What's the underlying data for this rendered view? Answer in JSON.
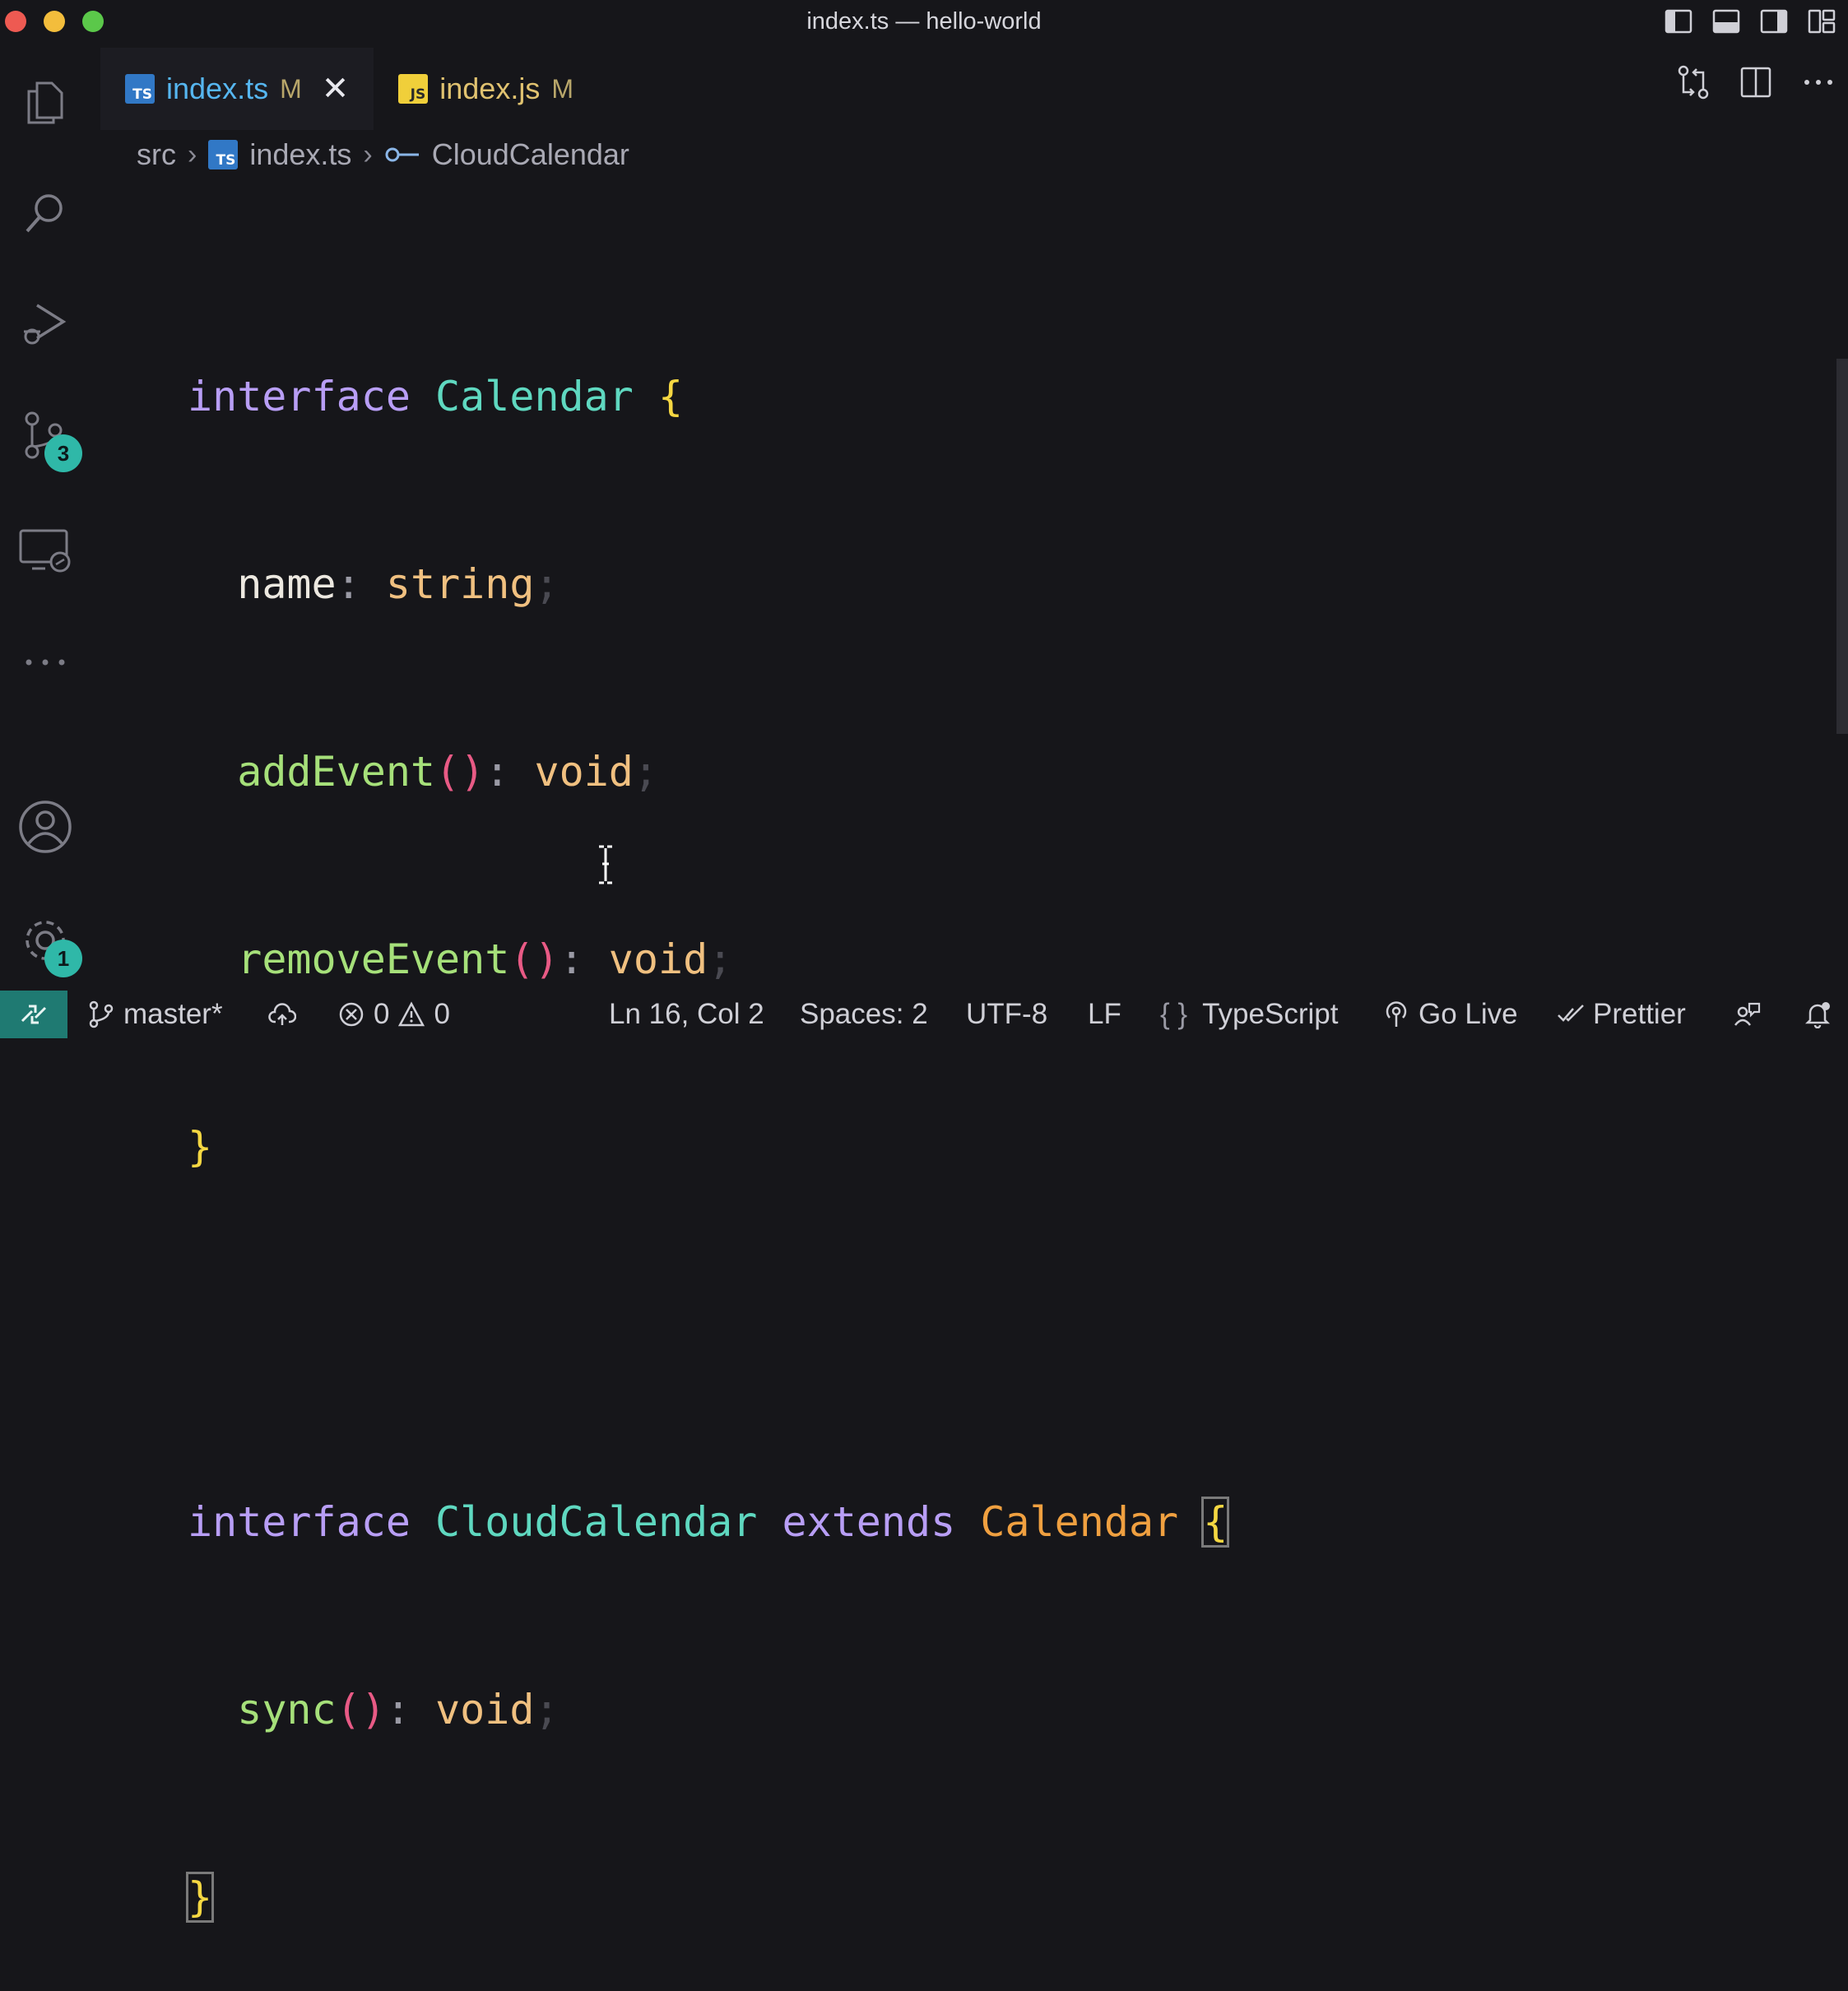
{
  "window": {
    "title": "index.ts — hello-world",
    "traffic_colors": {
      "close": "#ee5a52",
      "minimize": "#f3bd3c",
      "maximize": "#5bc84a"
    }
  },
  "activity_bar": {
    "items": [
      {
        "name": "explorer",
        "icon": "files-icon"
      },
      {
        "name": "search",
        "icon": "search-icon"
      },
      {
        "name": "run-debug",
        "icon": "run-debug-icon"
      },
      {
        "name": "source-control",
        "icon": "source-control-icon",
        "badge": "3"
      },
      {
        "name": "remote-explorer",
        "icon": "remote-explorer-icon"
      },
      {
        "name": "more",
        "icon": "ellipsis-icon"
      }
    ],
    "bottom": [
      {
        "name": "accounts",
        "icon": "account-icon"
      },
      {
        "name": "manage",
        "icon": "gear-icon",
        "badge": "1"
      }
    ]
  },
  "tabs": [
    {
      "label": "index.ts",
      "icon_text": "TS",
      "modified": "M",
      "active": true
    },
    {
      "label": "index.js",
      "icon_text": "JS",
      "modified": "M",
      "active": false
    }
  ],
  "breadcrumb": {
    "folder": "src",
    "file": "index.ts",
    "file_icon_text": "TS",
    "symbol": "CloudCalendar"
  },
  "code": {
    "lines": [
      "",
      "interface Calendar {",
      "  name: string;",
      "  addEvent(): void;",
      "  removeEvent(): void;",
      "}",
      "",
      "interface CloudCalendar extends Calendar {",
      "  sync(): void;",
      "}"
    ],
    "tokens": {
      "interface": "interface",
      "calendar": "Calendar",
      "cloud_calendar": "CloudCalendar",
      "extends": "extends",
      "name": "name",
      "string": "string",
      "add_event": "addEvent",
      "remove_event": "removeEvent",
      "sync": "sync",
      "void": "void",
      "parens": "()",
      "colon": ":",
      "semi": ";",
      "open_brace": "{",
      "close_brace": "}"
    }
  },
  "status_bar": {
    "branch": "master*",
    "errors": "0",
    "warnings": "0",
    "cursor_position": "Ln 16, Col 2",
    "indentation": "Spaces: 2",
    "encoding": "UTF-8",
    "line_ending": "LF",
    "language": "TypeScript",
    "language_icon": "{ }",
    "go_live": "Go Live",
    "prettier": "Prettier"
  }
}
